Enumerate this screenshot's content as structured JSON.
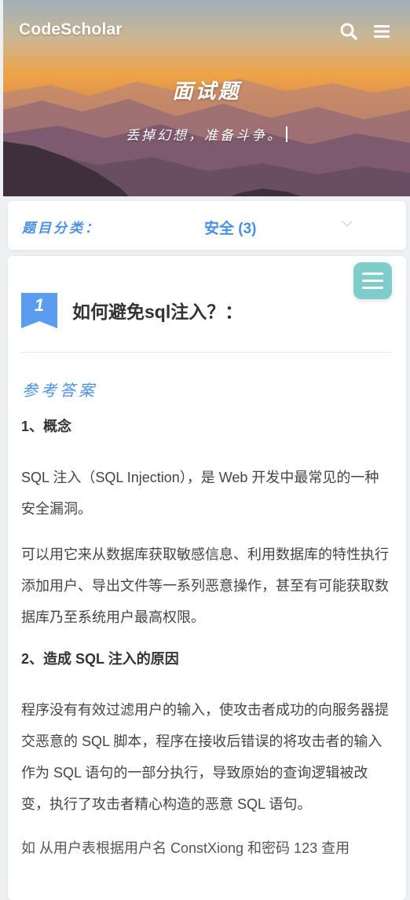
{
  "header": {
    "brand": "CodeScholar",
    "search_icon": "search-icon",
    "menu_icon": "hamburger-menu-icon",
    "hero_title": "面试题",
    "hero_subtitle": "丢掉幻想，准备斗争。"
  },
  "category": {
    "label": "题目分类：",
    "selected": "安全 (3)",
    "chevron_icon": "chevron-down-icon"
  },
  "question": {
    "number": "1",
    "title": "如何避免sql注入？："
  },
  "answer": {
    "section_title": "参考答案",
    "blocks": [
      {
        "type": "heading",
        "text": "1、概念"
      },
      {
        "type": "paragraph",
        "text": "SQL 注入（SQL Injection），是 Web 开发中最常见的一种安全漏洞。"
      },
      {
        "type": "paragraph",
        "text": "可以用它来从数据库获取敏感信息、利用数据库的特性执行添加用户、导出文件等一系列恶意操作，甚至有可能获取数据库乃至系统用户最高权限。"
      },
      {
        "type": "heading",
        "text": "2、造成 SQL 注入的原因"
      },
      {
        "type": "paragraph",
        "text": "程序没有有效过滤用户的输入，使攻击者成功的向服务器提交恶意的 SQL 脚本，程序在接收后错误的将攻击者的输入作为 SQL 语句的一部分执行，导致原始的查询逻辑被改变，执行了攻击者精心构造的恶意 SQL 语句。"
      },
      {
        "type": "paragraph",
        "text": "如 从用户表根据用户名 ConstXiong 和密码 123 查用"
      }
    ]
  },
  "colors": {
    "accent_blue": "#4a90e2",
    "fab_teal": "#7fcdca",
    "ribbon_blue": "#5b9cf0"
  }
}
